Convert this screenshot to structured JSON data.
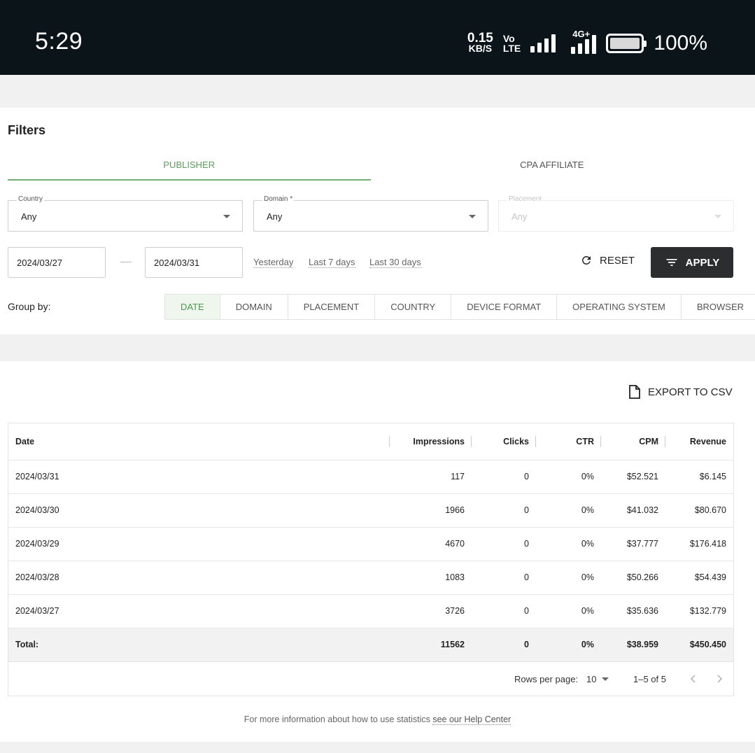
{
  "status_bar": {
    "time": "5:29",
    "speed_value": "0.15",
    "speed_unit": "KB/S",
    "volte_top": "Vo",
    "volte_bottom": "LTE",
    "network": "4G+",
    "battery": "100%"
  },
  "filters": {
    "title": "Filters",
    "tabs": [
      {
        "label": "PUBLISHER",
        "active": true
      },
      {
        "label": "CPA AFFILIATE",
        "active": false
      }
    ],
    "country": {
      "label": "Country",
      "value": "Any"
    },
    "domain": {
      "label": "Domain *",
      "value": "Any"
    },
    "placement": {
      "label": "Placement",
      "value": "Any",
      "disabled": true
    },
    "date_from": "2024/03/27",
    "date_to": "2024/03/31",
    "quick_ranges": [
      "Yesterday",
      "Last 7 days",
      "Last 30 days"
    ],
    "reset_label": "RESET",
    "apply_label": "APPLY",
    "group_by_label": "Group by:",
    "group_by": [
      {
        "label": "DATE",
        "active": true
      },
      {
        "label": "DOMAIN",
        "active": false
      },
      {
        "label": "PLACEMENT",
        "active": false
      },
      {
        "label": "COUNTRY",
        "active": false
      },
      {
        "label": "DEVICE FORMAT",
        "active": false
      },
      {
        "label": "OPERATING SYSTEM",
        "active": false
      },
      {
        "label": "BROWSER",
        "active": false
      }
    ]
  },
  "stats": {
    "export_label": "EXPORT TO CSV",
    "columns": [
      "Date",
      "Impressions",
      "Clicks",
      "CTR",
      "CPM",
      "Revenue"
    ],
    "rows": [
      [
        "2024/03/31",
        "117",
        "0",
        "0%",
        "$52.521",
        "$6.145"
      ],
      [
        "2024/03/30",
        "1966",
        "0",
        "0%",
        "$41.032",
        "$80.670"
      ],
      [
        "2024/03/29",
        "4670",
        "0",
        "0%",
        "$37.777",
        "$176.418"
      ],
      [
        "2024/03/28",
        "1083",
        "0",
        "0%",
        "$50.266",
        "$54.439"
      ],
      [
        "2024/03/27",
        "3726",
        "0",
        "0%",
        "$35.636",
        "$132.779"
      ]
    ],
    "total": [
      "Total:",
      "11562",
      "0",
      "0%",
      "$38.959",
      "$450.450"
    ],
    "rows_per_page_label": "Rows per page:",
    "rows_per_page_value": "10",
    "range_label": "1–5 of 5"
  },
  "help": {
    "text": "For more information about how to use statistics ",
    "link": "see our Help Center"
  },
  "colors": {
    "accent_green": "#5a9e5a",
    "apply_bg": "#2b2d2e",
    "status_bar_bg": "#0b1418"
  }
}
